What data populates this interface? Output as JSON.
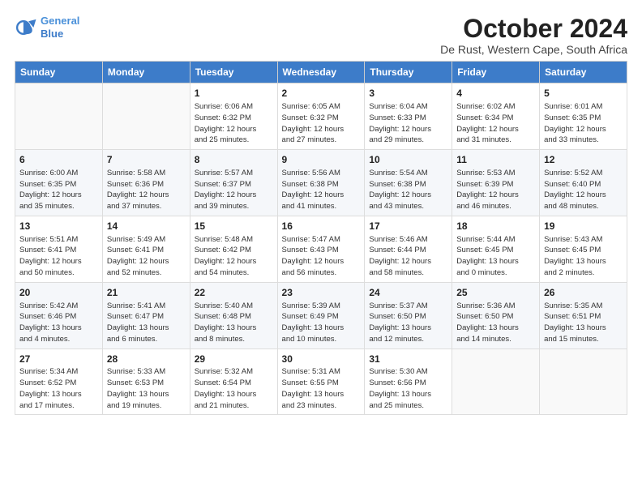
{
  "logo": {
    "line1": "General",
    "line2": "Blue"
  },
  "title": "October 2024",
  "location": "De Rust, Western Cape, South Africa",
  "weekdays": [
    "Sunday",
    "Monday",
    "Tuesday",
    "Wednesday",
    "Thursday",
    "Friday",
    "Saturday"
  ],
  "weeks": [
    [
      {
        "day": "",
        "info": ""
      },
      {
        "day": "",
        "info": ""
      },
      {
        "day": "1",
        "info": "Sunrise: 6:06 AM\nSunset: 6:32 PM\nDaylight: 12 hours\nand 25 minutes."
      },
      {
        "day": "2",
        "info": "Sunrise: 6:05 AM\nSunset: 6:32 PM\nDaylight: 12 hours\nand 27 minutes."
      },
      {
        "day": "3",
        "info": "Sunrise: 6:04 AM\nSunset: 6:33 PM\nDaylight: 12 hours\nand 29 minutes."
      },
      {
        "day": "4",
        "info": "Sunrise: 6:02 AM\nSunset: 6:34 PM\nDaylight: 12 hours\nand 31 minutes."
      },
      {
        "day": "5",
        "info": "Sunrise: 6:01 AM\nSunset: 6:35 PM\nDaylight: 12 hours\nand 33 minutes."
      }
    ],
    [
      {
        "day": "6",
        "info": "Sunrise: 6:00 AM\nSunset: 6:35 PM\nDaylight: 12 hours\nand 35 minutes."
      },
      {
        "day": "7",
        "info": "Sunrise: 5:58 AM\nSunset: 6:36 PM\nDaylight: 12 hours\nand 37 minutes."
      },
      {
        "day": "8",
        "info": "Sunrise: 5:57 AM\nSunset: 6:37 PM\nDaylight: 12 hours\nand 39 minutes."
      },
      {
        "day": "9",
        "info": "Sunrise: 5:56 AM\nSunset: 6:38 PM\nDaylight: 12 hours\nand 41 minutes."
      },
      {
        "day": "10",
        "info": "Sunrise: 5:54 AM\nSunset: 6:38 PM\nDaylight: 12 hours\nand 43 minutes."
      },
      {
        "day": "11",
        "info": "Sunrise: 5:53 AM\nSunset: 6:39 PM\nDaylight: 12 hours\nand 46 minutes."
      },
      {
        "day": "12",
        "info": "Sunrise: 5:52 AM\nSunset: 6:40 PM\nDaylight: 12 hours\nand 48 minutes."
      }
    ],
    [
      {
        "day": "13",
        "info": "Sunrise: 5:51 AM\nSunset: 6:41 PM\nDaylight: 12 hours\nand 50 minutes."
      },
      {
        "day": "14",
        "info": "Sunrise: 5:49 AM\nSunset: 6:41 PM\nDaylight: 12 hours\nand 52 minutes."
      },
      {
        "day": "15",
        "info": "Sunrise: 5:48 AM\nSunset: 6:42 PM\nDaylight: 12 hours\nand 54 minutes."
      },
      {
        "day": "16",
        "info": "Sunrise: 5:47 AM\nSunset: 6:43 PM\nDaylight: 12 hours\nand 56 minutes."
      },
      {
        "day": "17",
        "info": "Sunrise: 5:46 AM\nSunset: 6:44 PM\nDaylight: 12 hours\nand 58 minutes."
      },
      {
        "day": "18",
        "info": "Sunrise: 5:44 AM\nSunset: 6:45 PM\nDaylight: 13 hours\nand 0 minutes."
      },
      {
        "day": "19",
        "info": "Sunrise: 5:43 AM\nSunset: 6:45 PM\nDaylight: 13 hours\nand 2 minutes."
      }
    ],
    [
      {
        "day": "20",
        "info": "Sunrise: 5:42 AM\nSunset: 6:46 PM\nDaylight: 13 hours\nand 4 minutes."
      },
      {
        "day": "21",
        "info": "Sunrise: 5:41 AM\nSunset: 6:47 PM\nDaylight: 13 hours\nand 6 minutes."
      },
      {
        "day": "22",
        "info": "Sunrise: 5:40 AM\nSunset: 6:48 PM\nDaylight: 13 hours\nand 8 minutes."
      },
      {
        "day": "23",
        "info": "Sunrise: 5:39 AM\nSunset: 6:49 PM\nDaylight: 13 hours\nand 10 minutes."
      },
      {
        "day": "24",
        "info": "Sunrise: 5:37 AM\nSunset: 6:50 PM\nDaylight: 13 hours\nand 12 minutes."
      },
      {
        "day": "25",
        "info": "Sunrise: 5:36 AM\nSunset: 6:50 PM\nDaylight: 13 hours\nand 14 minutes."
      },
      {
        "day": "26",
        "info": "Sunrise: 5:35 AM\nSunset: 6:51 PM\nDaylight: 13 hours\nand 15 minutes."
      }
    ],
    [
      {
        "day": "27",
        "info": "Sunrise: 5:34 AM\nSunset: 6:52 PM\nDaylight: 13 hours\nand 17 minutes."
      },
      {
        "day": "28",
        "info": "Sunrise: 5:33 AM\nSunset: 6:53 PM\nDaylight: 13 hours\nand 19 minutes."
      },
      {
        "day": "29",
        "info": "Sunrise: 5:32 AM\nSunset: 6:54 PM\nDaylight: 13 hours\nand 21 minutes."
      },
      {
        "day": "30",
        "info": "Sunrise: 5:31 AM\nSunset: 6:55 PM\nDaylight: 13 hours\nand 23 minutes."
      },
      {
        "day": "31",
        "info": "Sunrise: 5:30 AM\nSunset: 6:56 PM\nDaylight: 13 hours\nand 25 minutes."
      },
      {
        "day": "",
        "info": ""
      },
      {
        "day": "",
        "info": ""
      }
    ]
  ]
}
